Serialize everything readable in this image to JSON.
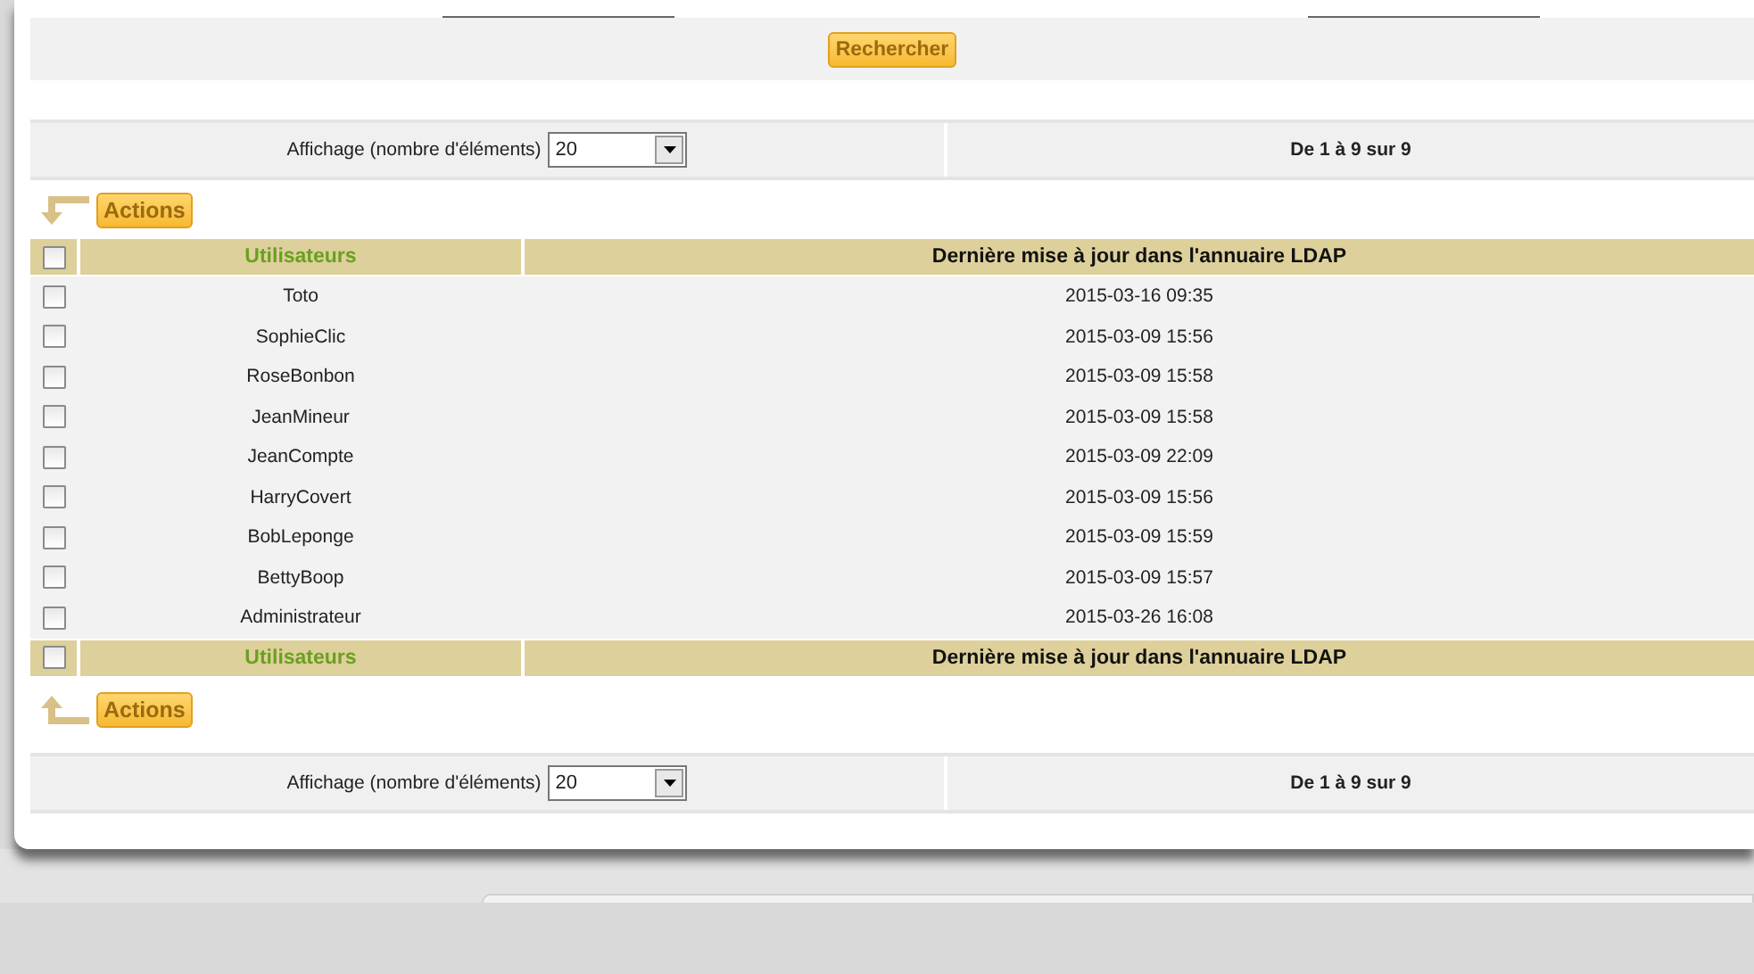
{
  "search": {
    "button": "Rechercher"
  },
  "pager_top": {
    "label": "Affichage (nombre d'éléments)",
    "page_size": "20",
    "range": "De 1 à 9 sur 9"
  },
  "actions_top": {
    "label": "Actions",
    "kind": "down"
  },
  "table": {
    "header_checked": false,
    "columns": [
      "Utilisateurs",
      "Dernière mise à jour dans l'annuaire LDAP"
    ],
    "rows": [
      {
        "checked": false,
        "user": "Toto",
        "updated": "2015-03-16 09:35"
      },
      {
        "checked": false,
        "user": "SophieClic",
        "updated": "2015-03-09 15:56"
      },
      {
        "checked": false,
        "user": "RoseBonbon",
        "updated": "2015-03-09 15:58"
      },
      {
        "checked": false,
        "user": "JeanMineur",
        "updated": "2015-03-09 15:58"
      },
      {
        "checked": false,
        "user": "JeanCompte",
        "updated": "2015-03-09 22:09"
      },
      {
        "checked": false,
        "user": "HarryCovert",
        "updated": "2015-03-09 15:56"
      },
      {
        "checked": false,
        "user": "BobLeponge",
        "updated": "2015-03-09 15:59"
      },
      {
        "checked": false,
        "user": "BettyBoop",
        "updated": "2015-03-09 15:57"
      },
      {
        "checked": false,
        "user": "Administrateur",
        "updated": "2015-03-26 16:08"
      }
    ],
    "footer_checked": false,
    "footer_columns": [
      "Utilisateurs",
      "Dernière mise à jour dans l'annuaire LDAP"
    ]
  },
  "actions_bottom": {
    "label": "Actions",
    "kind": "up"
  },
  "pager_bottom": {
    "label": "Affichage (nombre d'éléments)",
    "page_size": "20",
    "range": "De 1 à 9 sur 9"
  }
}
